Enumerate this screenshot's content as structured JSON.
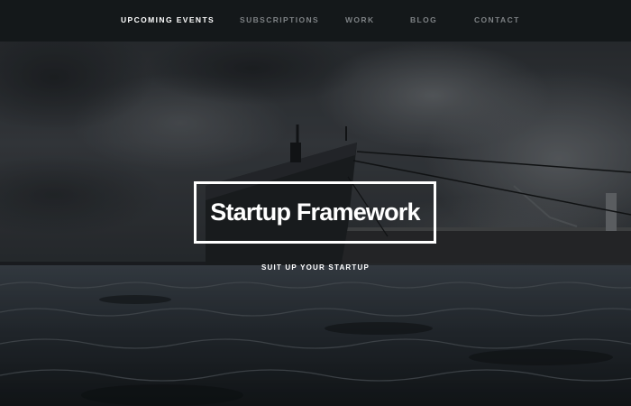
{
  "nav": {
    "items": [
      {
        "label": "UPCOMING EVENTS",
        "active": true
      },
      {
        "label": "SUBSCRIPTIONS",
        "active": false
      },
      {
        "label": "WORK",
        "active": false
      },
      {
        "label": "BLOG",
        "active": false
      },
      {
        "label": "CONTACT",
        "active": false
      }
    ]
  },
  "hero": {
    "title": "Startup Framework",
    "tagline": "SUIT UP YOUR STARTUP"
  },
  "colors": {
    "nav_background": "#14181a",
    "nav_active": "#ffffff",
    "nav_inactive": "#7d8184",
    "title_border": "#ffffff"
  }
}
